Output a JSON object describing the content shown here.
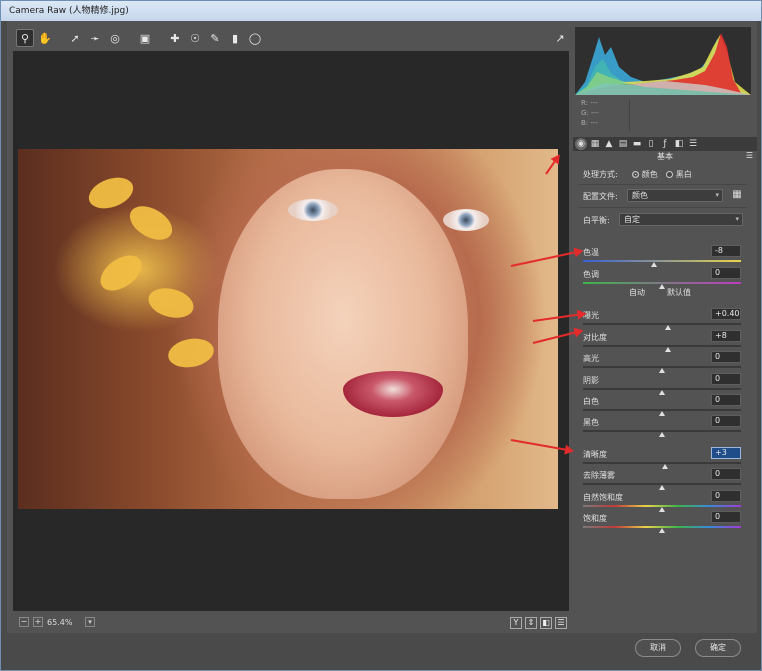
{
  "window": {
    "title": "Camera Raw (人物精修.jpg)"
  },
  "toolbar": {
    "tools": [
      "zoom-tool-icon",
      "hand-tool-icon",
      "white-balance-tool-icon",
      "color-sampler-tool-icon",
      "targeted-adjustment-tool-icon",
      "crop-tool-icon",
      "straighten-tool-icon",
      "spot-removal-tool-icon",
      "red-eye-tool-icon",
      "adjustment-brush-icon",
      "graduated-filter-icon",
      "radial-filter-icon"
    ],
    "right_icon": "open-preferences-icon"
  },
  "canvas": {
    "zoom_value": "65.4%",
    "zoom_out": "−",
    "zoom_in": "+",
    "view_buttons": [
      "Y",
      "⇕",
      "◧",
      "☰"
    ]
  },
  "histogram": {
    "r_label": "R:",
    "g_label": "G:",
    "b_label": "B:",
    "r_value": "---",
    "g_value": "---",
    "b_value": "---"
  },
  "panel": {
    "section_title": "基本",
    "treatment_label": "处理方式:",
    "treatment_color": "颜色",
    "treatment_bw": "黑白",
    "profile_label": "配置文件:",
    "profile_value": "颜色",
    "wb_label": "白平衡:",
    "wb_value": "自定",
    "auto_label": "自动",
    "default_label": "默认值",
    "sliders": [
      {
        "label": "色温",
        "value": "-8",
        "pos": 0.45
      },
      {
        "label": "色调",
        "value": "0",
        "pos": 0.5
      },
      {
        "label": "曝光",
        "value": "+0.40",
        "pos": 0.54
      },
      {
        "label": "对比度",
        "value": "+8",
        "pos": 0.54
      },
      {
        "label": "高光",
        "value": "0",
        "pos": 0.5
      },
      {
        "label": "阴影",
        "value": "0",
        "pos": 0.5
      },
      {
        "label": "白色",
        "value": "0",
        "pos": 0.5
      },
      {
        "label": "黑色",
        "value": "0",
        "pos": 0.5
      },
      {
        "label": "清晰度",
        "value": "+3",
        "pos": 0.52
      },
      {
        "label": "去除薄雾",
        "value": "0",
        "pos": 0.5
      },
      {
        "label": "自然饱和度",
        "value": "0",
        "pos": 0.5
      },
      {
        "label": "饱和度",
        "value": "0",
        "pos": 0.5
      }
    ]
  },
  "buttons": {
    "cancel": "取消",
    "ok": "确定"
  },
  "colors": {
    "annotation_arrow": "#e42b2b",
    "highlight": "#1f4d8a"
  }
}
